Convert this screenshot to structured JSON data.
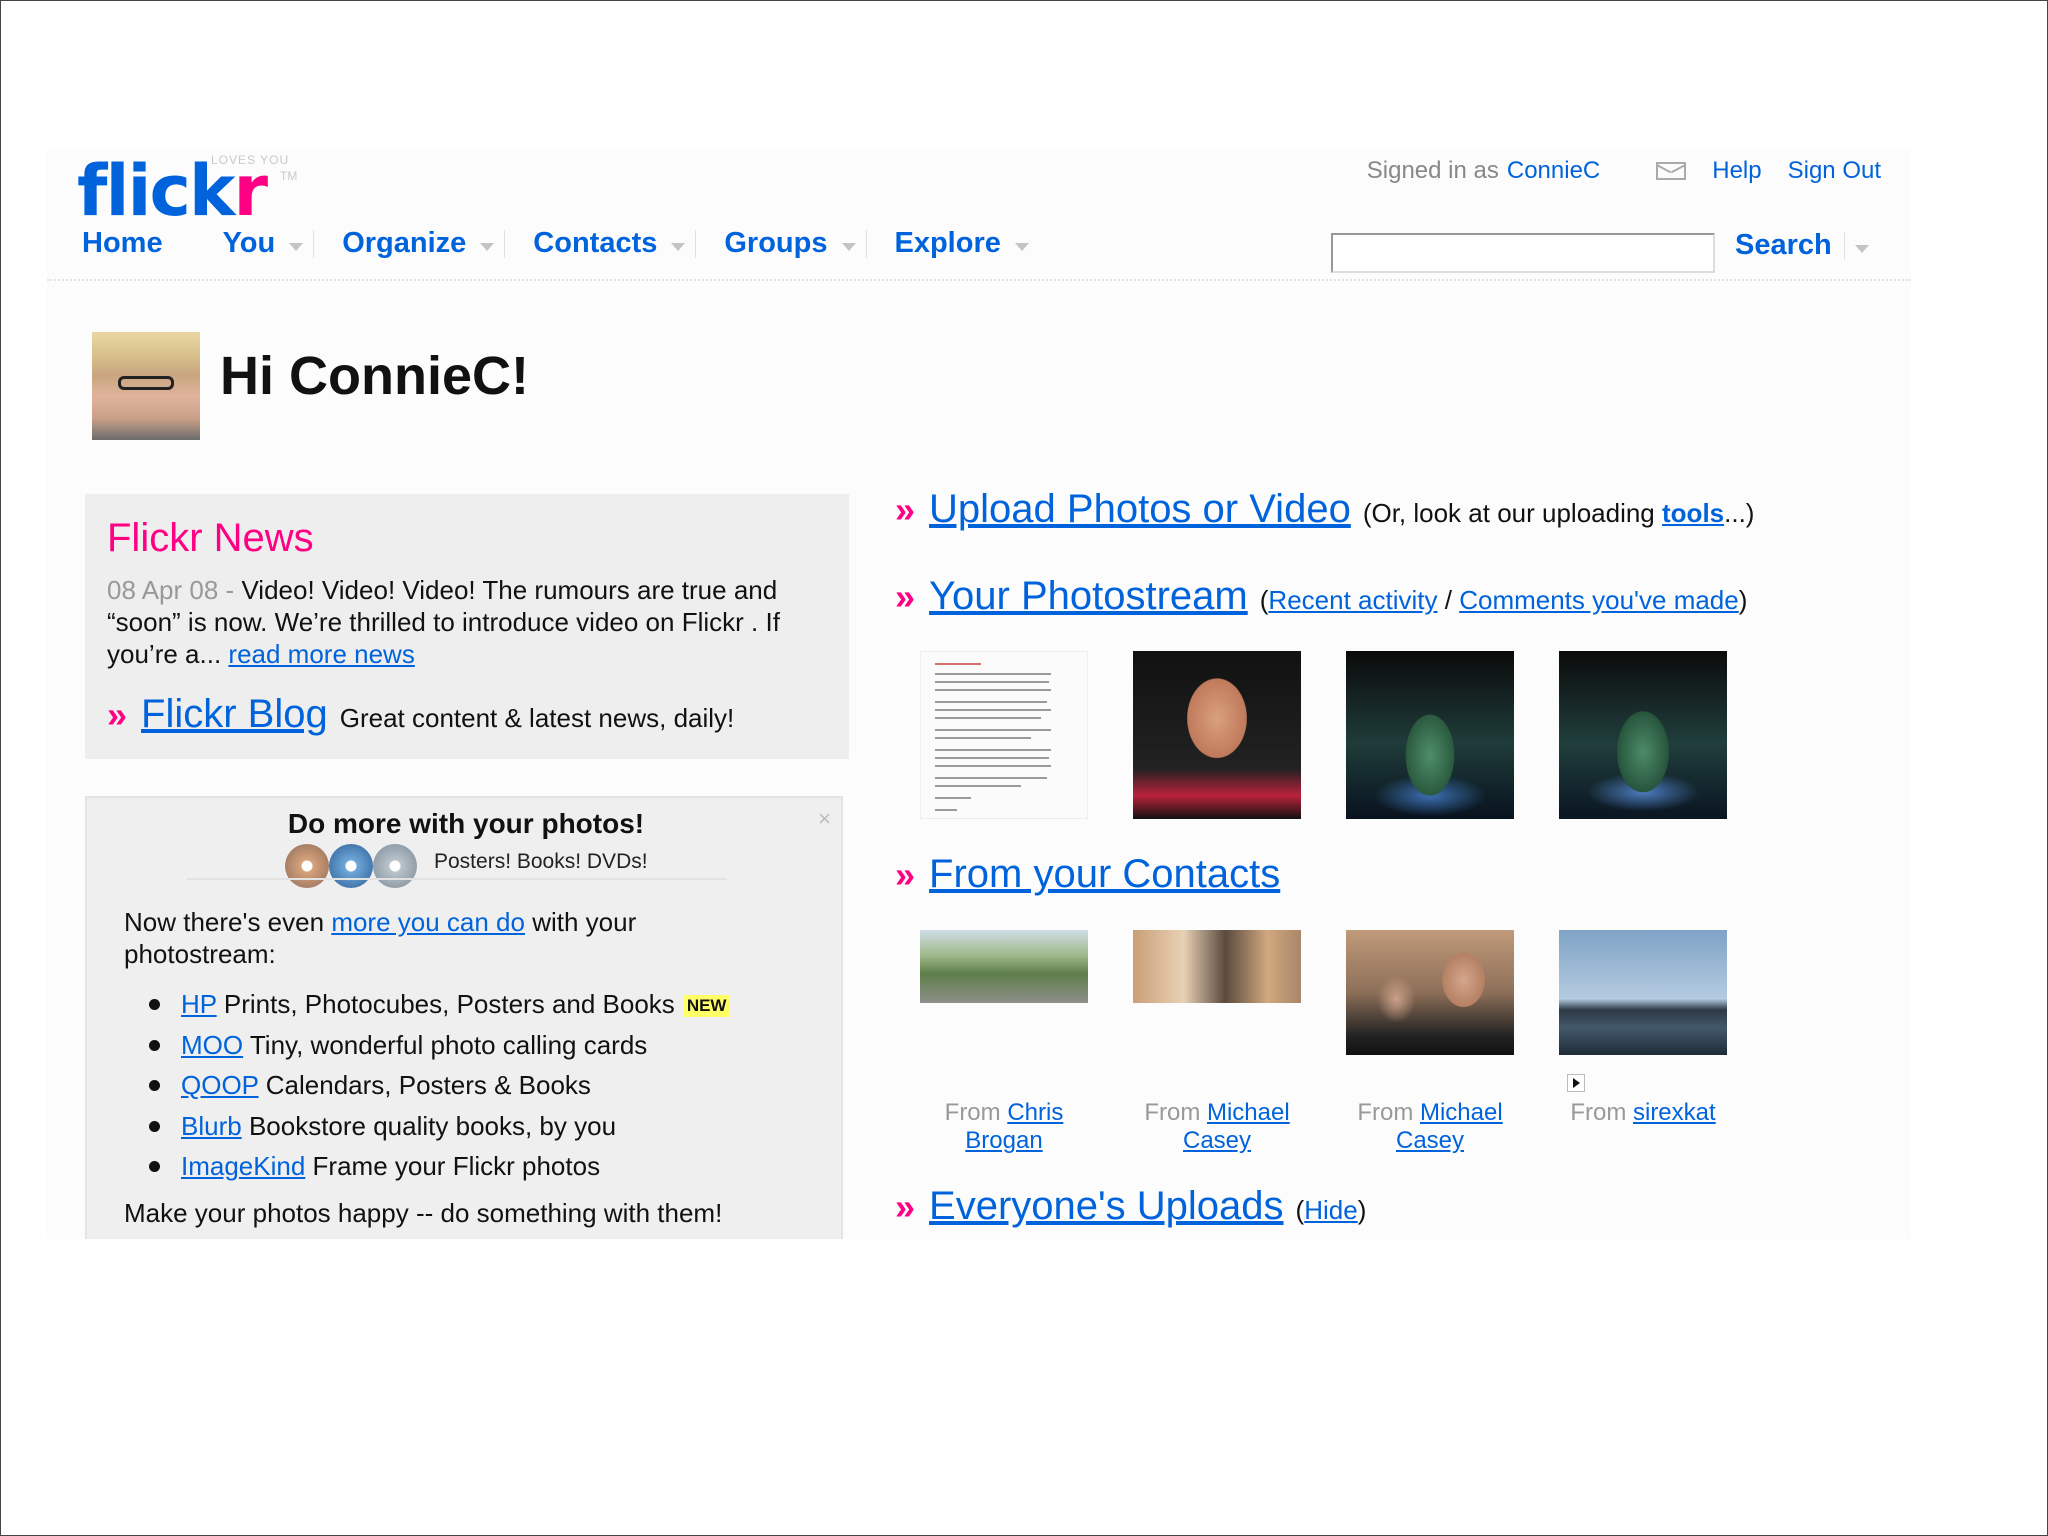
{
  "header": {
    "logo_main": "flick",
    "logo_accent": "r",
    "logo_tag": "LOVES YOU",
    "logo_tm": "TM",
    "signed_in_label": "Signed in as",
    "username": "ConnieC",
    "help": "Help",
    "sign_out": "Sign Out"
  },
  "nav": {
    "items": [
      "Home",
      "You",
      "Organize",
      "Contacts",
      "Groups",
      "Explore"
    ],
    "search_button": "Search",
    "search_value": ""
  },
  "greeting": "Hi ConnieC!",
  "news": {
    "title": "Flickr News",
    "date": "08 Apr 08 -",
    "text": "Video! Video! Video! The rumours are true and “soon” is now. We’re thrilled to introduce video on Flickr . If you’re a...",
    "more_link": "read more news",
    "blog_link": "Flickr Blog",
    "blog_text": "Great content & latest news, daily!"
  },
  "promo": {
    "close": "×",
    "title": "Do more with your photos!",
    "subtitle": "Posters! Books! DVDs!",
    "intro_pre": "Now there's even",
    "intro_link": "more you can do",
    "intro_post": "with your photostream:",
    "items": [
      {
        "link": "HP",
        "text": "Prints, Photocubes, Posters and Books",
        "badge": "NEW"
      },
      {
        "link": "MOO",
        "text": "Tiny, wonderful photo calling cards",
        "badge": ""
      },
      {
        "link": "QOOP",
        "text": "Calendars, Posters & Books",
        "badge": ""
      },
      {
        "link": "Blurb",
        "text": "Bookstore quality books, by you",
        "badge": ""
      },
      {
        "link": "ImageKind",
        "text": "Frame your Flickr photos",
        "badge": ""
      }
    ],
    "outro": "Make your photos happy -- do something with them!"
  },
  "sections": {
    "chevron": "»",
    "upload": {
      "link": "Upload Photos or Video",
      "pre": "(Or, look at our uploading",
      "tools": "tools",
      "post": "...)"
    },
    "photostream": {
      "link": "Your Photostream",
      "open": "(",
      "recent": "Recent activity",
      "slash": "/",
      "comments": "Comments you've made",
      "close": ")"
    },
    "contacts": {
      "link": "From your Contacts"
    },
    "everyone": {
      "link": "Everyone's Uploads",
      "open": "(",
      "hide": "Hide",
      "close": ")"
    }
  },
  "contacts": [
    {
      "from": "From",
      "name_1": "Chris",
      "name_2": "Brogan"
    },
    {
      "from": "From",
      "name_1": "Michael",
      "name_2": "Casey"
    },
    {
      "from": "From",
      "name_1": "Michael",
      "name_2": "Casey"
    },
    {
      "from": "From",
      "name_1": "sirexkat",
      "name_2": ""
    }
  ],
  "colors": {
    "flickr_blue": "#0063dc",
    "flickr_pink": "#ff0084"
  }
}
